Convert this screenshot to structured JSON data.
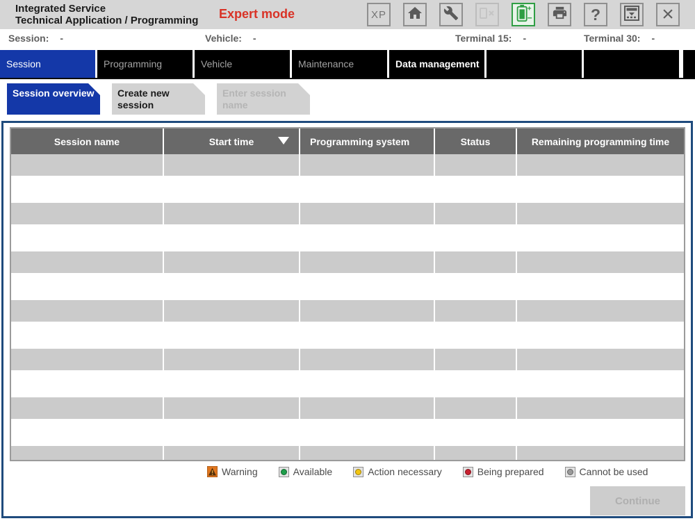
{
  "window": {
    "title_line1": "Integrated Service",
    "title_line2": "Technical Application / Programming",
    "mode": "Expert mode"
  },
  "toolbar": {
    "icons": [
      {
        "name": "xp-button",
        "label": "XP",
        "interactable": true
      },
      {
        "name": "home-icon",
        "interactable": true
      },
      {
        "name": "wrench-settings-icon",
        "interactable": true
      },
      {
        "name": "disconnect-icon",
        "disabled": true,
        "interactable": false
      },
      {
        "name": "battery-status-icon",
        "status_color": "#2f9e44",
        "interactable": true
      },
      {
        "name": "print-icon",
        "interactable": true
      },
      {
        "name": "help-icon",
        "label": "?",
        "interactable": true
      },
      {
        "name": "hide-panel-icon",
        "interactable": true
      },
      {
        "name": "close-icon",
        "label": "×",
        "interactable": true
      }
    ]
  },
  "status_bar": {
    "fields": [
      {
        "label": "Session:",
        "value": "-"
      },
      {
        "label": "Vehicle:",
        "value": "-"
      },
      {
        "label": "Terminal 15:",
        "value": "-"
      },
      {
        "label": "Terminal 30:",
        "value": "-"
      }
    ]
  },
  "main_tabs": [
    {
      "label": "Session",
      "state": "active",
      "interactable": true
    },
    {
      "label": "Programming",
      "state": "inactive",
      "interactable": true
    },
    {
      "label": "Vehicle",
      "state": "inactive",
      "interactable": true
    },
    {
      "label": "Maintenance",
      "state": "inactive",
      "interactable": true
    },
    {
      "label": "Data management",
      "state": "emphasis",
      "interactable": true
    },
    {
      "label": "",
      "state": "empty",
      "interactable": false
    },
    {
      "label": "",
      "state": "empty",
      "interactable": false
    }
  ],
  "sub_tabs": [
    {
      "label": "Session overview",
      "state": "active",
      "interactable": true
    },
    {
      "label": "Create new session",
      "state": "normal",
      "interactable": true
    },
    {
      "label": "Enter session name",
      "state": "disabled",
      "interactable": false
    }
  ],
  "table": {
    "columns": [
      {
        "label": "Session name",
        "state": "",
        "interactable": true
      },
      {
        "label": "Start time",
        "state": "sorted",
        "interactable": true
      },
      {
        "label": "Programming system",
        "state": "left",
        "interactable": true
      },
      {
        "label": "Status",
        "state": "",
        "interactable": true
      },
      {
        "label": "Remaining programming time",
        "state": "",
        "interactable": true
      }
    ],
    "empty_row_count": 7
  },
  "legend": {
    "items": [
      {
        "name": "warning",
        "label": "Warning",
        "type": "warning",
        "color": "#e0761f"
      },
      {
        "name": "available",
        "label": "Available",
        "type": "dot",
        "color": "#1e9e4a"
      },
      {
        "name": "action-necessary",
        "label": "Action necessary",
        "type": "dot",
        "color": "#f2c511"
      },
      {
        "name": "being-prepared",
        "label": "Being prepared",
        "type": "dot",
        "color": "#c8202f"
      },
      {
        "name": "cannot-be-used",
        "label": "Cannot be used",
        "type": "dot",
        "color": "#9a9a9a"
      }
    ]
  },
  "footer": {
    "continue_label": "Continue"
  },
  "colors": {
    "accent_blue": "#1438a8",
    "frame_blue": "#1f4b7d",
    "expert_red": "#d93226",
    "table_header_gray": "#696969",
    "row_gray": "#cbcbcb"
  }
}
